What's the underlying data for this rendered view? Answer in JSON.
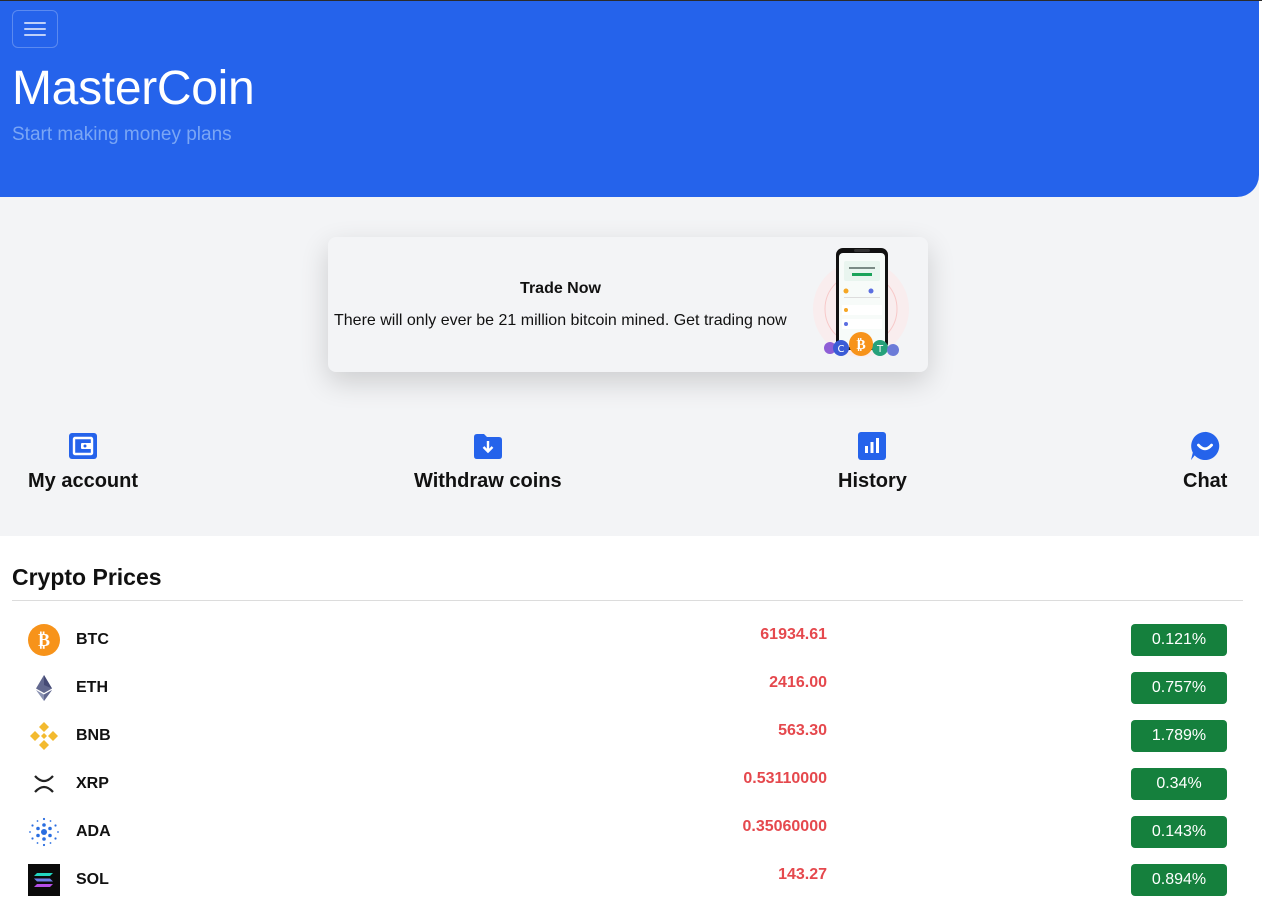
{
  "header": {
    "brand": "MasterCoin",
    "tagline": "Start making money plans",
    "menu_icon": "hamburger-icon"
  },
  "promo": {
    "title": "Trade Now",
    "text": "There will only ever be 21 million bitcoin mined. Get trading now"
  },
  "quick_actions": [
    {
      "label": "My account",
      "icon": "wallet-icon"
    },
    {
      "label": "Withdraw coins",
      "icon": "folder-download-icon"
    },
    {
      "label": "History",
      "icon": "bar-chart-icon"
    },
    {
      "label": "Chat",
      "icon": "chat-icon"
    }
  ],
  "prices": {
    "title": "Crypto Prices",
    "rows": [
      {
        "symbol": "BTC",
        "price": "61934.61",
        "change": "0.121%",
        "icon": "bitcoin-icon"
      },
      {
        "symbol": "ETH",
        "price": "2416.00",
        "change": "0.757%",
        "icon": "ethereum-icon"
      },
      {
        "symbol": "BNB",
        "price": "563.30",
        "change": "1.789%",
        "icon": "bnb-icon"
      },
      {
        "symbol": "XRP",
        "price": "0.53110000",
        "change": "0.34%",
        "icon": "xrp-icon"
      },
      {
        "symbol": "ADA",
        "price": "0.35060000",
        "change": "0.143%",
        "icon": "cardano-icon"
      },
      {
        "symbol": "SOL",
        "price": "143.27",
        "change": "0.894%",
        "icon": "solana-icon"
      }
    ]
  },
  "colors": {
    "primary": "#2563eb",
    "price_red": "#e5484d",
    "change_green": "#15803d"
  }
}
